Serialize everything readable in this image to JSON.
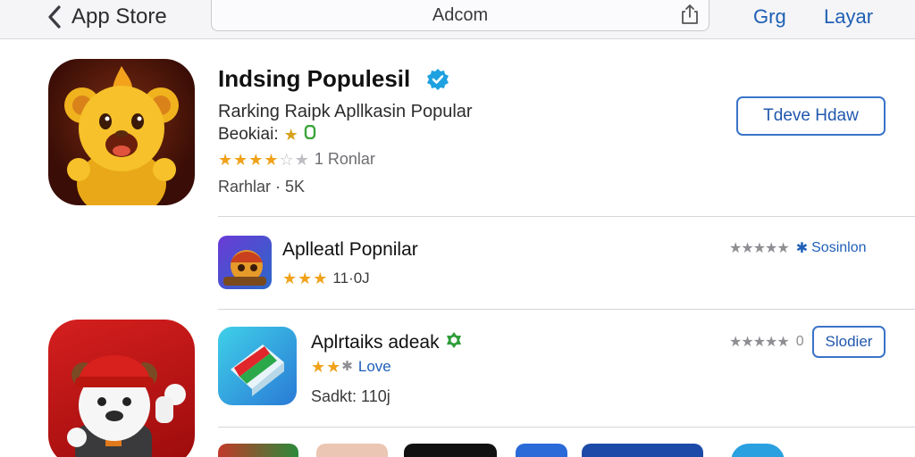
{
  "header": {
    "back_label": "App Store",
    "url": "Adcom",
    "nav_left": "Grg",
    "nav_right": "Layar"
  },
  "featured": {
    "title": "Indsing Populesil",
    "subtitle": "Rarking Raipk Apllkasin Popular",
    "category": "Beokiai:",
    "rating_text": "1 Ronlar",
    "rank_text": "Rarhlar · 5K",
    "button": "Tdeve Hdaw",
    "stars": 4
  },
  "rows": [
    {
      "title": "Aplleatl Popnilar",
      "meta": "11·0J",
      "stars": 3,
      "right_link": "Sosinlon"
    },
    {
      "title": "Aplrtaiks adeak",
      "meta_link": "Love",
      "meta2": "Sadkt: 110j",
      "stars": 2,
      "right_count": "0",
      "button": "Slodier"
    }
  ],
  "colors": {
    "accent": "#2158ad",
    "star": "#f0a21a",
    "verified": "#1ea1e0",
    "badge_green": "#3aa53a"
  }
}
